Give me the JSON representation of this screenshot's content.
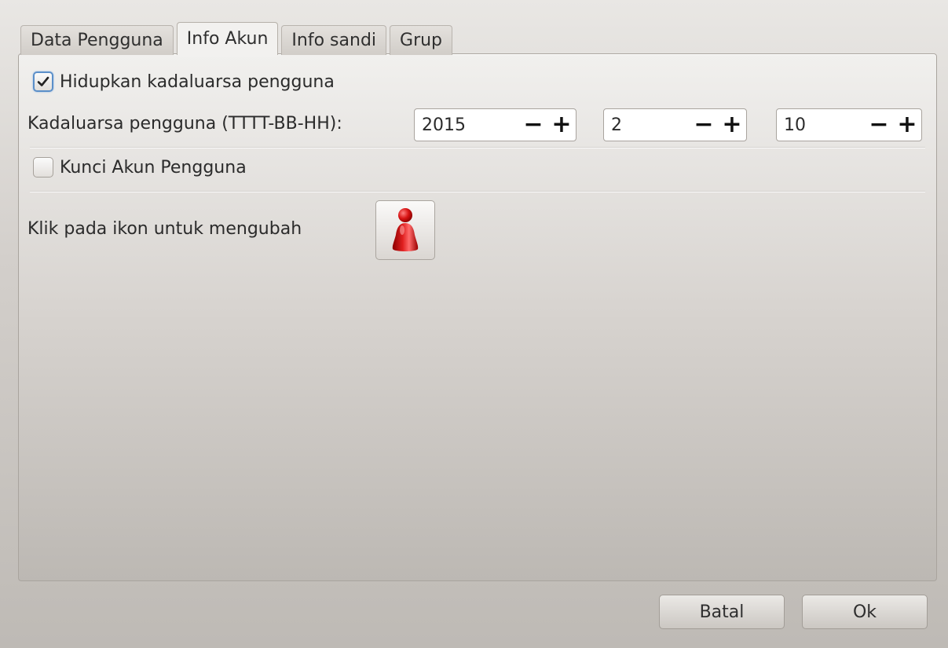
{
  "tabs": [
    {
      "label": "Data Pengguna",
      "active": false
    },
    {
      "label": "Info Akun",
      "active": true
    },
    {
      "label": "Info sandi",
      "active": false
    },
    {
      "label": "Grup",
      "active": false
    }
  ],
  "expiry_checkbox": {
    "label": "Hidupkan kadaluarsa pengguna",
    "checked": true
  },
  "expiry_date": {
    "label": "Kadaluarsa pengguna (TTTT-BB-HH):",
    "year": "2015",
    "month": "2",
    "day": "10",
    "minus": "−",
    "plus": "+"
  },
  "lock_checkbox": {
    "label": "Kunci Akun Pengguna",
    "checked": false
  },
  "icon_row": {
    "label": "Klik pada ikon untuk mengubah",
    "icon": "user-avatar-icon"
  },
  "buttons": {
    "cancel": "Batal",
    "ok": "Ok"
  },
  "colors": {
    "accent": "#5b8fc9",
    "avatar": "#d01010"
  }
}
